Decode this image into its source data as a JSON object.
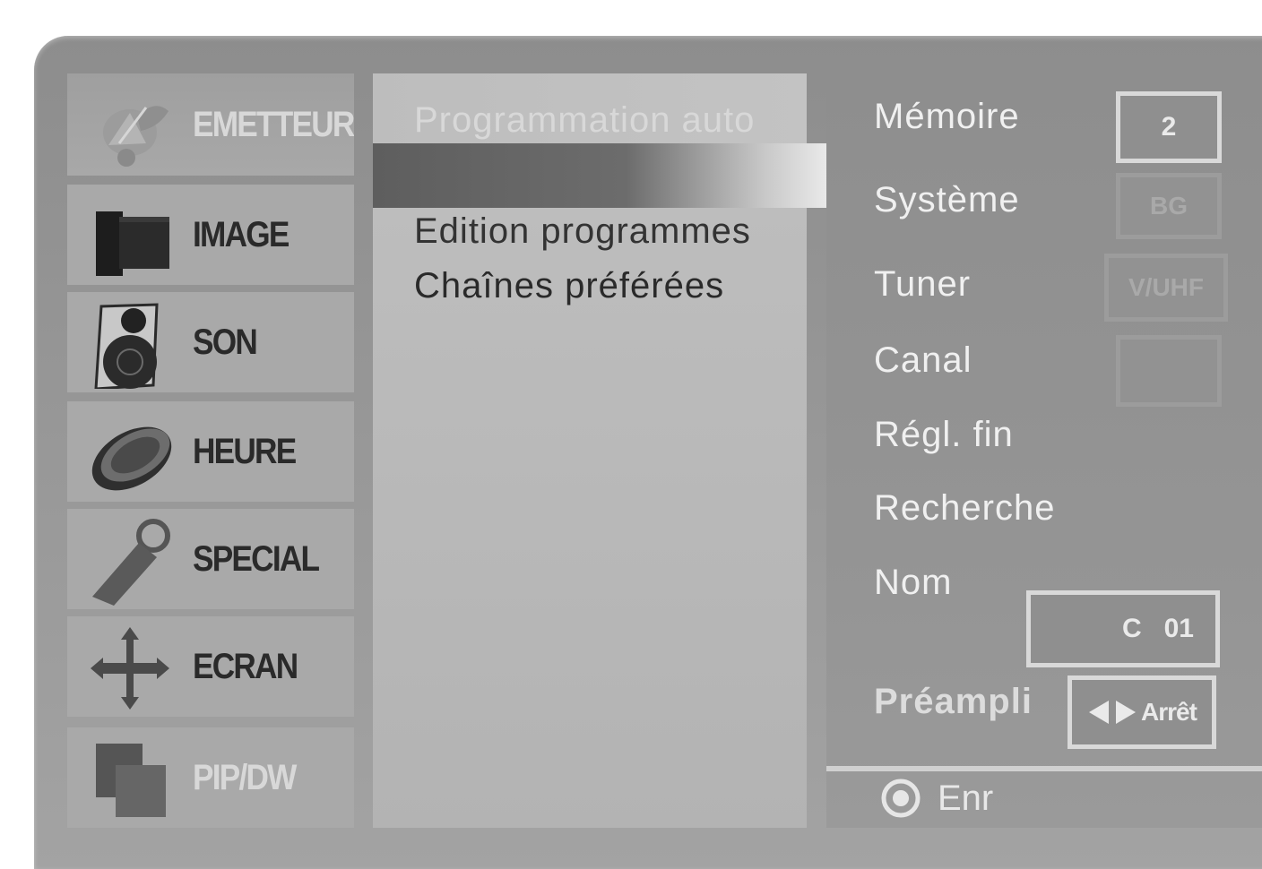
{
  "menu": {
    "items": [
      {
        "label": "EMETTEUR",
        "icon": "satellite-dish-icon"
      },
      {
        "label": "IMAGE",
        "icon": "picture-block-icon"
      },
      {
        "label": "SON",
        "icon": "speaker-icon"
      },
      {
        "label": "HEURE",
        "icon": "clock-disc-icon"
      },
      {
        "label": "SPECIAL",
        "icon": "tag-key-icon"
      },
      {
        "label": "ECRAN",
        "icon": "move-arrows-icon"
      },
      {
        "label": "PIP/DW",
        "icon": "pip-windows-icon"
      }
    ]
  },
  "submenu": {
    "items": [
      {
        "label": "Programmation auto"
      },
      {
        "label": "Edition programmes"
      },
      {
        "label": "Chaînes préférées"
      }
    ]
  },
  "settings": {
    "memoire": {
      "label": "Mémoire",
      "value": "2"
    },
    "systeme": {
      "label": "Système",
      "value": "BG"
    },
    "tuner": {
      "label": "Tuner",
      "value": "V/UHF"
    },
    "canal": {
      "label": "Canal",
      "value": ""
    },
    "regl_fin": {
      "label": "Régl. fin"
    },
    "recherche": {
      "label": "Recherche"
    },
    "nom": {
      "label": "Nom",
      "value": "C   01"
    },
    "preampli": {
      "label": "Préampli",
      "value": "Arrêt",
      "icon": "left-right-arrows-icon"
    },
    "enr": {
      "label": "Enr",
      "icon": "ok-button-icon"
    }
  },
  "colors": {
    "frame": "#9a9a9a",
    "menu_item": "#a9a9a9",
    "selected_bar": "#5e5e5e",
    "panel_text_light": "#f0f0f0",
    "menu_text": "#2a2a2a"
  }
}
